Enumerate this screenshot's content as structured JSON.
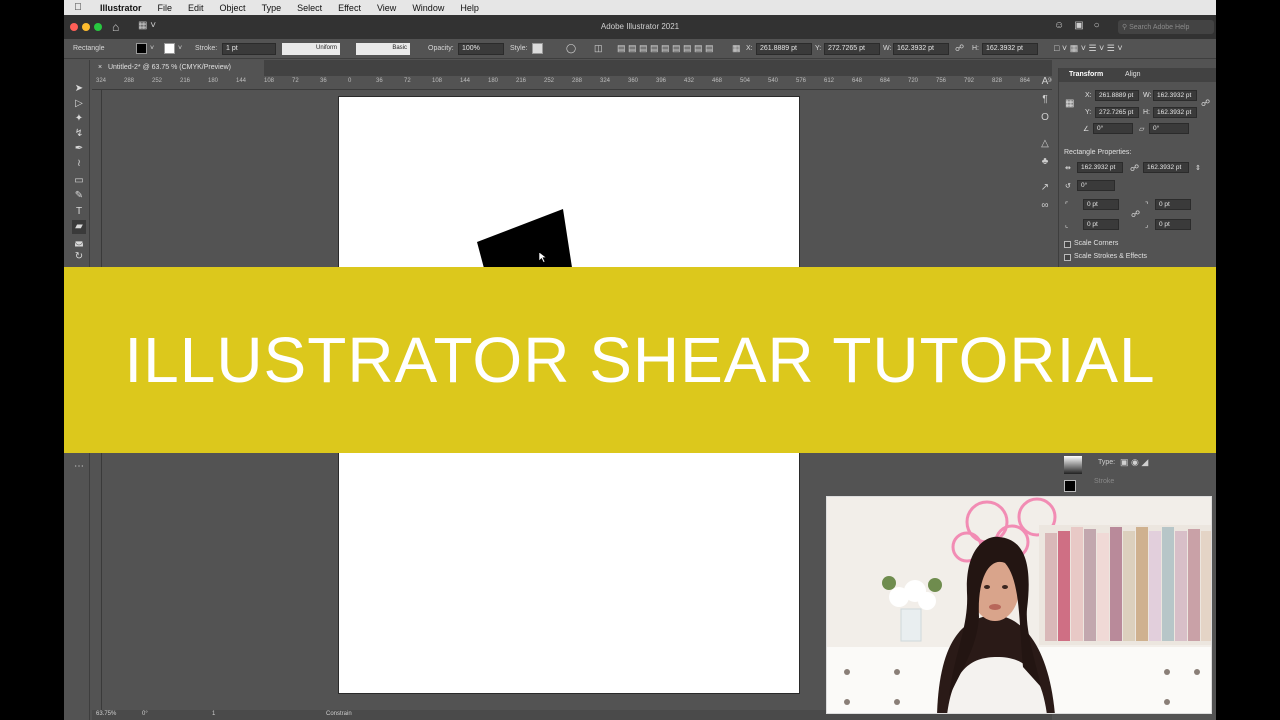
{
  "menubar": {
    "items": [
      "Illustrator",
      "File",
      "Edit",
      "Object",
      "Type",
      "Select",
      "Effect",
      "View",
      "Window",
      "Help"
    ]
  },
  "titlebar": {
    "title": "Adobe Illustrator 2021",
    "search_placeholder": "Search Adobe Help"
  },
  "controlbar": {
    "object_type": "Rectangle",
    "stroke_label": "Stroke:",
    "stroke_value": "1 pt",
    "profile_value": "Uniform",
    "brush_value": "Basic",
    "opacity_label": "Opacity:",
    "opacity_value": "100%",
    "style_label": "Style:",
    "x_label": "X:",
    "x_value": "261.8889 pt",
    "y_label": "Y:",
    "y_value": "272.7265 pt",
    "w_label": "W:",
    "w_value": "162.3932 pt",
    "h_label": "H:",
    "h_value": "162.3932 pt"
  },
  "document_tab": {
    "label": "Untitled-2* @ 63.75 % (CMYK/Preview)"
  },
  "ruler": {
    "ticks": [
      "324",
      "288",
      "252",
      "216",
      "180",
      "144",
      "108",
      "72",
      "36",
      "0",
      "36",
      "72",
      "108",
      "144",
      "180",
      "216",
      "252",
      "288",
      "324",
      "360",
      "396",
      "432",
      "468",
      "504",
      "540",
      "576",
      "612",
      "648",
      "684",
      "720",
      "756",
      "792",
      "828",
      "864",
      "900"
    ]
  },
  "transform_panel": {
    "tabs": [
      "Transform",
      "Align"
    ],
    "x_label": "X:",
    "x_value": "261.8889 pt",
    "y_label": "Y:",
    "y_value": "272.7265 pt",
    "w_label": "W:",
    "w_value": "162.3932 pt",
    "h_label": "H:",
    "h_value": "162.3932 pt",
    "angle_value": "0°",
    "shear_value": "0°",
    "rect_props_title": "Rectangle Properties:",
    "rect_w": "162.3932 pt",
    "rect_h": "162.3932 pt",
    "rect_angle": "0°",
    "corner_tl": "0 pt",
    "corner_tr": "0 pt",
    "corner_bl": "0 pt",
    "corner_br": "0 pt",
    "scale_corners_label": "Scale Corners",
    "scale_strokes_label": "Scale Strokes & Effects"
  },
  "gradient_panel": {
    "type_label": "Type:",
    "stroke_label": "Stroke"
  },
  "statusbar": {
    "zoom": "63.75%",
    "rotation": "0°",
    "artboard_index": "1",
    "tool_hint": "Constrain"
  },
  "banner": {
    "text": "ILLUSTRATOR SHEAR TUTORIAL",
    "color": "#dcc81c"
  }
}
